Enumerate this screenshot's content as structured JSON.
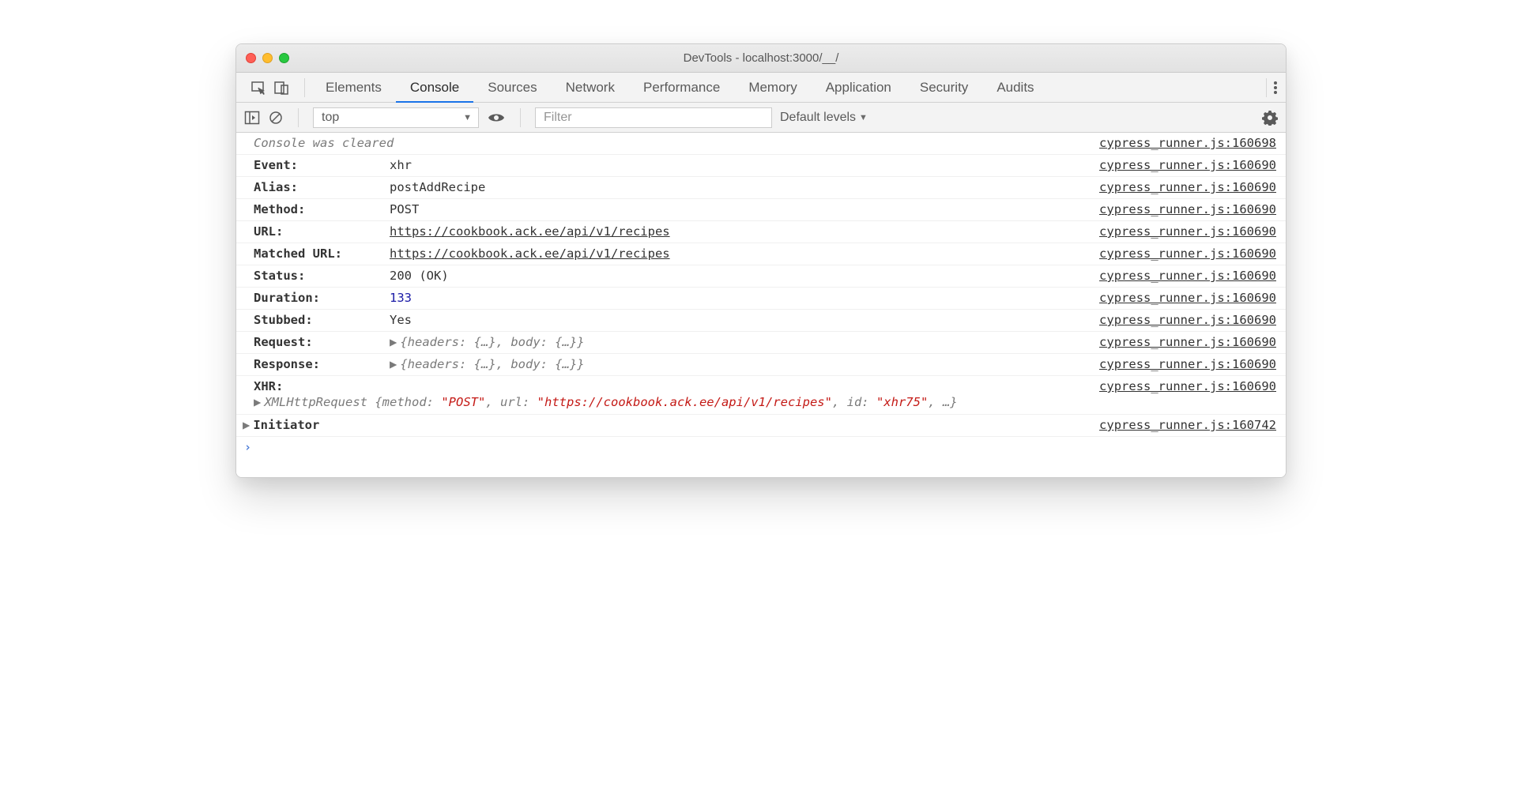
{
  "window": {
    "title": "DevTools - localhost:3000/__/"
  },
  "tabs": [
    "Elements",
    "Console",
    "Sources",
    "Network",
    "Performance",
    "Memory",
    "Application",
    "Security",
    "Audits"
  ],
  "activeTab": "Console",
  "toolbar": {
    "context": "top",
    "filter_placeholder": "Filter",
    "levels": "Default levels"
  },
  "cleared": "Console was cleared",
  "cleared_src": "cypress_runner.js:160698",
  "rows": [
    {
      "label": "Event:",
      "type": "text",
      "value": "xhr",
      "src": "cypress_runner.js:160690"
    },
    {
      "label": "Alias:",
      "type": "text",
      "value": "postAddRecipe",
      "src": "cypress_runner.js:160690"
    },
    {
      "label": "Method:",
      "type": "text",
      "value": "POST",
      "src": "cypress_runner.js:160690"
    },
    {
      "label": "URL:",
      "type": "link",
      "value": "https://cookbook.ack.ee/api/v1/recipes",
      "src": "cypress_runner.js:160690"
    },
    {
      "label": "Matched URL:",
      "type": "link",
      "value": "https://cookbook.ack.ee/api/v1/recipes",
      "src": "cypress_runner.js:160690"
    },
    {
      "label": "Status:",
      "type": "text",
      "value": "200 (OK)",
      "src": "cypress_runner.js:160690"
    },
    {
      "label": "Duration:",
      "type": "number",
      "value": "133",
      "src": "cypress_runner.js:160690"
    },
    {
      "label": "Stubbed:",
      "type": "text",
      "value": "Yes",
      "src": "cypress_runner.js:160690"
    },
    {
      "label": "Request:",
      "type": "expand",
      "value": "{headers: {…}, body: {…}}",
      "src": "cypress_runner.js:160690"
    },
    {
      "label": "Response:",
      "type": "expand",
      "value": "{headers: {…}, body: {…}}",
      "src": "cypress_runner.js:160690"
    }
  ],
  "xhr": {
    "label": "XHR:",
    "src": "cypress_runner.js:160690",
    "prefix": "XMLHttpRequest ",
    "open": "{",
    "k_method": "method: ",
    "v_method": "\"POST\"",
    "sep1": ", ",
    "k_url": "url: ",
    "v_url": "\"https://cookbook.ack.ee/api/v1/recipes\"",
    "sep2": ", ",
    "k_id": "id: ",
    "v_id": "\"xhr75\"",
    "tail": ", …}"
  },
  "initiator": {
    "label": "Initiator",
    "src": "cypress_runner.js:160742"
  }
}
